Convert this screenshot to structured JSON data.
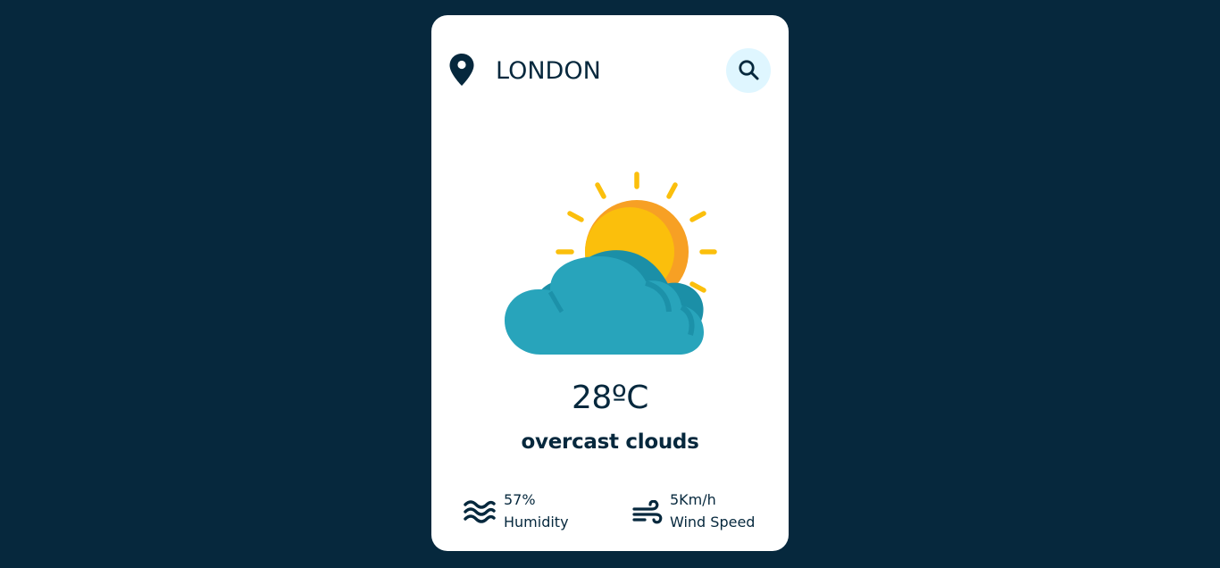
{
  "search": {
    "location_value": "LONDON",
    "search_icon": "search-icon",
    "location_icon": "map-pin-icon"
  },
  "weather": {
    "icon": "sun-behind-cloud-icon",
    "temperature": "28ºC",
    "description": "overcast clouds"
  },
  "details": {
    "humidity": {
      "icon": "water-waves-icon",
      "value": "57%",
      "label": "Humidity"
    },
    "wind": {
      "icon": "wind-icon",
      "value": "5Km/h",
      "label": "Wind Speed"
    }
  },
  "colors": {
    "background": "#06283d",
    "card": "#ffffff",
    "text": "#06283d",
    "search_button_bg": "#dff6ff",
    "sun": "#fbbf0c",
    "sun_shade": "#f7a024",
    "cloud": "#28a4bb",
    "cloud_shade": "#1b8fa7"
  }
}
